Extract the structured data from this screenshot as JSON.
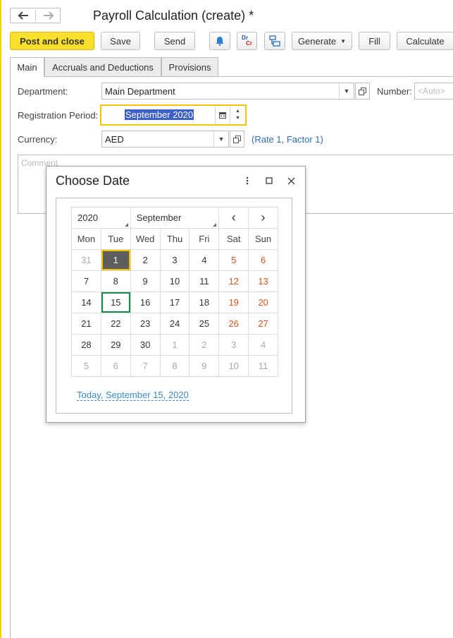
{
  "window": {
    "title": "Payroll Calculation (create) *",
    "nav": {
      "back_icon": "arrow-left-icon",
      "forward_icon": "arrow-right-icon"
    }
  },
  "toolbar": {
    "post_and_close": "Post and close",
    "save": "Save",
    "send": "Send",
    "dr": "Dr",
    "cr": "Cr",
    "generate": "Generate",
    "fill": "Fill",
    "calculate": "Calculate"
  },
  "tabs": [
    {
      "label": "Main",
      "active": true
    },
    {
      "label": "Accruals and Deductions",
      "active": false
    },
    {
      "label": "Provisions",
      "active": false
    }
  ],
  "form": {
    "department_label": "Department:",
    "department_value": "Main Department",
    "number_label": "Number:",
    "number_placeholder": "<Auto>",
    "registration_label": "Registration Period:",
    "registration_value": "September 2020",
    "currency_label": "Currency:",
    "currency_value": "AED",
    "rate_link": "(Rate 1, Factor 1)",
    "comment_placeholder": "Comment"
  },
  "date_picker": {
    "title": "Choose Date",
    "year": "2020",
    "month": "September",
    "prev": "‹",
    "next": "›",
    "weekdays": [
      "Mon",
      "Tue",
      "Wed",
      "Thu",
      "Fri",
      "Sat",
      "Sun"
    ],
    "weeks": [
      [
        "31",
        "1",
        "2",
        "3",
        "4",
        "5",
        "6"
      ],
      [
        "7",
        "8",
        "9",
        "10",
        "11",
        "12",
        "13"
      ],
      [
        "14",
        "15",
        "16",
        "17",
        "18",
        "19",
        "20"
      ],
      [
        "21",
        "22",
        "23",
        "24",
        "25",
        "26",
        "27"
      ],
      [
        "28",
        "29",
        "30",
        "1",
        "2",
        "3",
        "4"
      ],
      [
        "5",
        "6",
        "7",
        "8",
        "9",
        "10",
        "11"
      ]
    ],
    "selected_day": "1",
    "today_day": "15",
    "today_link": "Today, September 15, 2020"
  },
  "colors": {
    "accent_yellow": "#fbe02b",
    "weekend": "#e0541c",
    "link": "#2a6fb7",
    "selection": "#3d5fc9",
    "today_border": "#1a8a4a"
  }
}
